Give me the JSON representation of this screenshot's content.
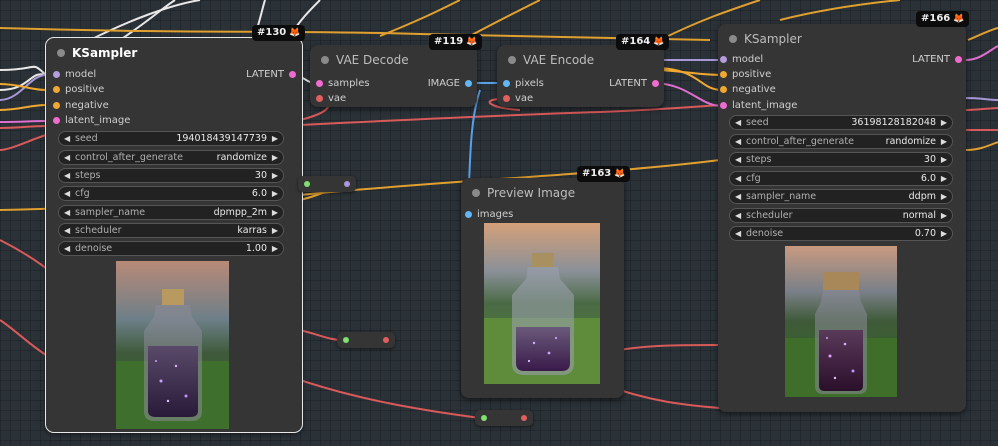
{
  "colors": {
    "model": "#b39ddb",
    "positive": "#f0a830",
    "negative": "#f0a830",
    "latent": "#f06bd0",
    "vae": "#e06060",
    "image": "#64b5f6",
    "wire_orange": "#e0a030",
    "wire_red": "#d85a5a",
    "wire_white": "#e8e8e8",
    "wire_purple": "#a898d8",
    "wire_pink": "#e070d0",
    "wire_blue": "#5aa0e8"
  },
  "ksampler_130": {
    "badge": "#130",
    "title": "KSampler",
    "inputs": [
      "model",
      "positive",
      "negative",
      "latent_image"
    ],
    "output": "LATENT",
    "widgets": [
      {
        "name": "seed",
        "value": "194018439147739"
      },
      {
        "name": "control_after_generate",
        "value": "randomize"
      },
      {
        "name": "steps",
        "value": "30"
      },
      {
        "name": "cfg",
        "value": "6.0"
      },
      {
        "name": "sampler_name",
        "value": "dpmpp_2m"
      },
      {
        "name": "scheduler",
        "value": "karras"
      },
      {
        "name": "denoise",
        "value": "1.00"
      }
    ]
  },
  "vae_decode_119": {
    "badge": "#119",
    "title": "VAE Decode",
    "inputs": [
      "samples",
      "vae"
    ],
    "output": "IMAGE"
  },
  "vae_encode_164": {
    "badge": "#164",
    "title": "VAE Encode",
    "inputs": [
      "pixels",
      "vae"
    ],
    "output": "LATENT"
  },
  "preview_163": {
    "badge": "#163",
    "title": "Preview Image",
    "inputs": [
      "images"
    ]
  },
  "ksampler_166": {
    "badge": "#166",
    "title": "KSampler",
    "inputs": [
      "model",
      "positive",
      "negative",
      "latent_image"
    ],
    "output": "LATENT",
    "widgets": [
      {
        "name": "seed",
        "value": "36198128182048"
      },
      {
        "name": "control_after_generate",
        "value": "randomize"
      },
      {
        "name": "steps",
        "value": "30"
      },
      {
        "name": "cfg",
        "value": "6.0"
      },
      {
        "name": "sampler_name",
        "value": "ddpm"
      },
      {
        "name": "scheduler",
        "value": "normal"
      },
      {
        "name": "denoise",
        "value": "0.70"
      }
    ]
  },
  "icons": {
    "badge_icon": "fox-icon",
    "arrow_left": "arrow-left-icon",
    "arrow_right": "arrow-right-icon"
  }
}
